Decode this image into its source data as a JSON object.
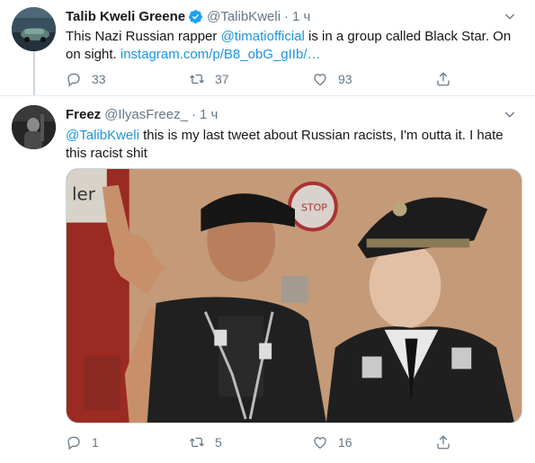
{
  "tweets": [
    {
      "display_name": "Talib Kweli Greene",
      "verified": true,
      "handle": "@TalibKweli",
      "separator": "·",
      "time": "1 ч",
      "text_before_mention": "This Nazi Russian rapper ",
      "mention": "@timatiofficial",
      "text_after_mention": " is in a group called Black Star. On on sight. ",
      "link": "instagram.com/p/B8_obG_gIIb/…",
      "replies": "33",
      "retweets": "37",
      "likes": "93"
    },
    {
      "display_name": "Freez",
      "handle": "@IlyasFreez_",
      "separator": "·",
      "time": "1 ч",
      "mention": "@TalibKweli",
      "text_after_mention": " this is my last tweet about Russian racists, I'm outta it. I hate this racist shit",
      "replies": "1",
      "retweets": "5",
      "likes": "16",
      "media_signs": [
        "ler",
        "STOP"
      ]
    }
  ],
  "icons": {
    "verified": "verified-badge-icon",
    "caret": "chevron-down-icon",
    "reply": "reply-icon",
    "retweet": "retweet-icon",
    "like": "heart-icon",
    "share": "share-icon"
  },
  "colors": {
    "link": "#1b95e0",
    "verified": "#1da1f2",
    "secondary_text": "#657786",
    "divider": "#e6ecf0"
  }
}
